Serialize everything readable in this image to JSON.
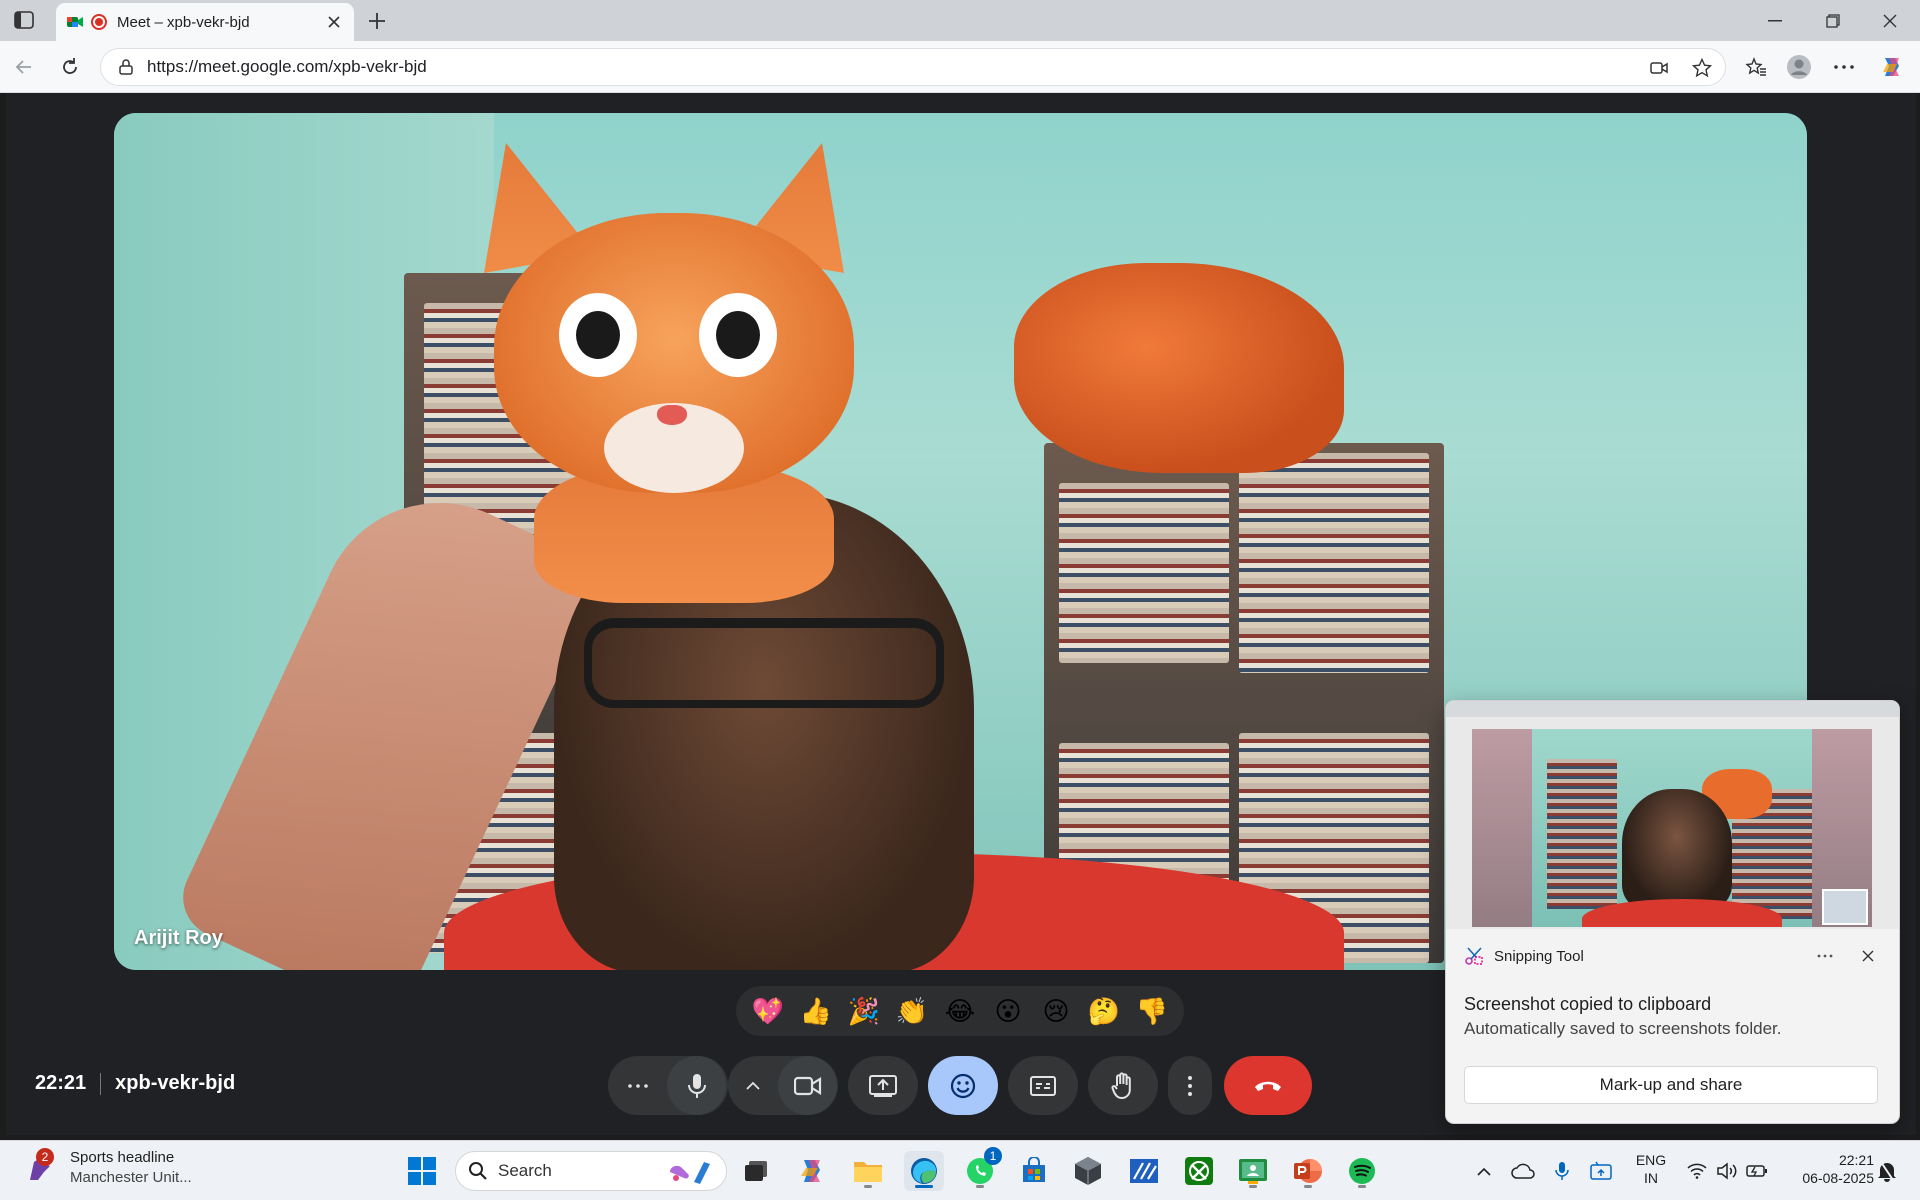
{
  "browser": {
    "tab_title": "Meet – xpb-vekr-bjd",
    "url": "https://meet.google.com/xpb-vekr-bjd"
  },
  "meet": {
    "participant_name": "Arijit Roy",
    "time": "22:21",
    "meeting_code": "xpb-vekr-bjd",
    "reactions": [
      "💖",
      "👍",
      "🎉",
      "👏",
      "😂",
      "😮",
      "😢",
      "🤔",
      "👎"
    ],
    "controls": [
      "more-options",
      "microphone",
      "camera-options",
      "camera",
      "present-screen",
      "reactions",
      "captions",
      "raise-hand",
      "more-actions",
      "leave-call"
    ]
  },
  "snipping_tool": {
    "app_name": "Snipping Tool",
    "title": "Screenshot copied to clipboard",
    "subtitle": "Automatically saved to screenshots folder.",
    "button": "Mark-up and share"
  },
  "taskbar": {
    "news_badge": "2",
    "news_title": "Sports headline",
    "news_sub": "Manchester Unit...",
    "search_placeholder": "Search",
    "whatsapp_badge": "1",
    "lang_top": "ENG",
    "lang_bottom": "IN",
    "clock_time": "22:21",
    "clock_date": "06-08-2025"
  },
  "colors": {
    "end_call": "#dc362e",
    "active_control": "#a8c7fa",
    "meet_bg": "#202124"
  }
}
